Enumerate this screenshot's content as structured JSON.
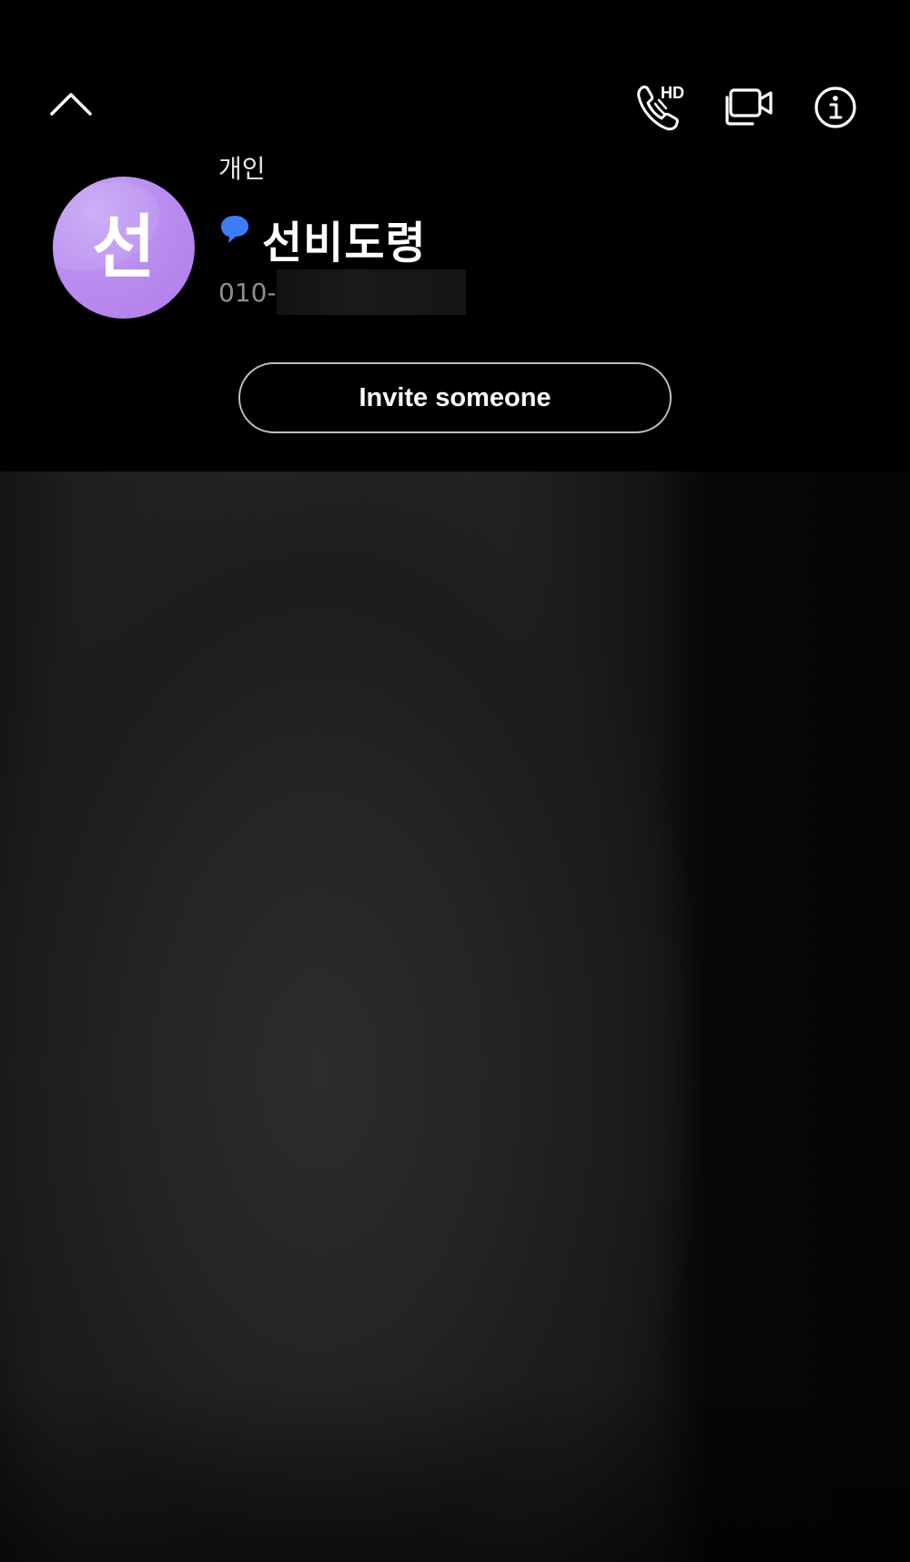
{
  "header": {
    "collapse_icon": "chevron-up-icon",
    "hd_call_icon": "hd-voice-call-icon",
    "hd_label": "HD",
    "video_call_icon": "video-call-icon",
    "info_icon": "info-icon"
  },
  "contact": {
    "type_label": "개인",
    "avatar_initial": "선",
    "name": "선비도령",
    "phone_prefix": "010-",
    "phone_redacted": true,
    "badge_icon": "chat-bubble-icon",
    "badge_color": "#3d7cf4",
    "avatar_color": "#b98ef0"
  },
  "actions": {
    "invite_label": "Invite someone"
  }
}
